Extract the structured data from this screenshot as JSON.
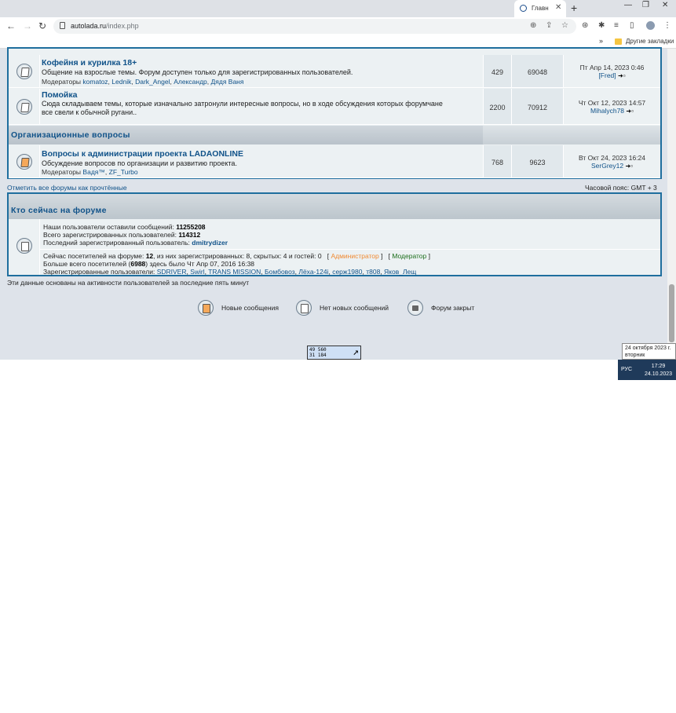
{
  "browser": {
    "tab_title": "Главн",
    "url_host": "autolada.ru",
    "url_path": "/index.php",
    "bookmarks_more": "»",
    "bookmarks_folder": "Другие закладки"
  },
  "forums": [
    {
      "title": "Кофейня и курилка 18+",
      "description": "Общение на взрослые темы. Форум доступен только для зарегистрированных пользователей.",
      "moderators_label": "Модераторы",
      "moderators": [
        "komatoz",
        "Lednik",
        "Dark_Angel",
        "Александр",
        "Дядя Ваня"
      ],
      "topics": "429",
      "posts": "69048",
      "last_date": "Пт Апр 14, 2023 0:46",
      "last_user": "[Fred]"
    },
    {
      "title": "Помойка",
      "description_line1": "Сюда складываем темы, которые изначально затронули интересные вопросы, но в ходе обсуждения которых форумчане",
      "description_line2": "все свели к обычной ругани..",
      "topics": "2200",
      "posts": "70912",
      "last_date": "Чт Окт 12, 2023 14:57",
      "last_user": "Mihalych78"
    }
  ],
  "category": {
    "title": "Организационные вопросы"
  },
  "admin_forum": {
    "title": "Вопросы к администрации проекта LADAONLINE",
    "description": "Обсуждение вопросов по организации и развитию проекта.",
    "moderators_label": "Модераторы",
    "moderators": [
      "Вадя™",
      "ZF_Turbo"
    ],
    "topics": "768",
    "posts": "9623",
    "last_date": "Вт Окт 24, 2023 16:24",
    "last_user": "SerGrey12"
  },
  "links": {
    "mark_read": "Отметить все форумы как прочтённые",
    "timezone": "Часовой пояс: GMT + 3"
  },
  "online": {
    "title": "Кто сейчас на форуме",
    "posts_text": "Наши пользователи оставили сообщений:",
    "posts_count": "11255208",
    "users_text": "Всего зарегистрированных пользователей:",
    "users_count": "114312",
    "last_user_text": "Последний зарегистрированный пользователь:",
    "last_user": "dmitrydizer",
    "now_text_a": "Сейчас посетителей на форуме:",
    "now_count": "12",
    "now_text_b": ", из них зарегистрированных: 8, скрытых: 4 и гостей: 0   [",
    "admin_label": "Администратор",
    "now_text_c": "]   [",
    "mod_label": "Модератор",
    "now_text_d": "]",
    "max_text_a": "Больше всего посетителей (",
    "max_count": "6988",
    "max_text_b": ") здесь было Чт Апр 07, 2016 16:38",
    "reg_users_label": "Зарегистрированные пользователи:",
    "reg_users": [
      "SDRIVER",
      "Swirl",
      "TRANS MISSION",
      "Бомбовоз",
      "Лёха-124i",
      "серж1980",
      "т808",
      "Яков_Лещ"
    ],
    "footnote": "Эти данные основаны на активности пользователей за последние пять минут"
  },
  "legend": {
    "new_posts": "Новые сообщения",
    "no_new_posts": "Нет новых сообщений",
    "locked": "Форум закрыт"
  },
  "counter": {
    "line1": "49 560",
    "line2": "31 184"
  },
  "taskbar": {
    "tooltip_line1": "24 октября 2023 г.",
    "tooltip_line2": "вторник",
    "lang": "РУС",
    "time": "17:29",
    "date": "24.10.2023"
  }
}
